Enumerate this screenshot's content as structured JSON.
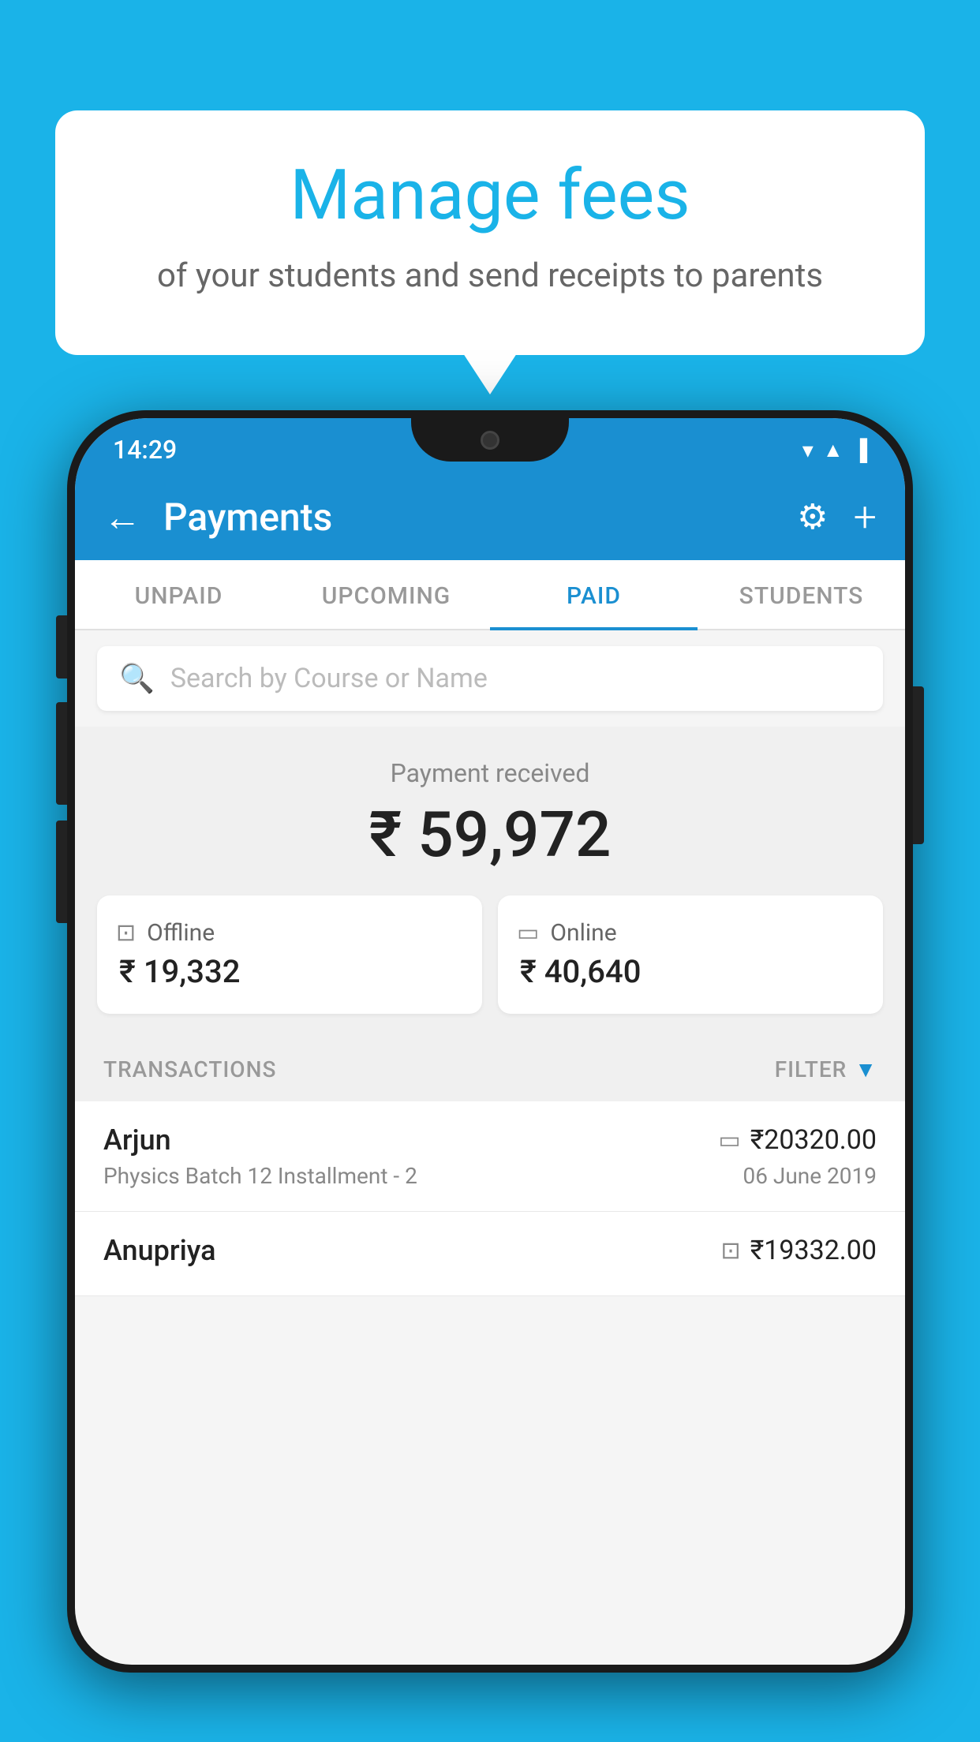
{
  "background_color": "#1ab3e8",
  "bubble": {
    "title": "Manage fees",
    "subtitle": "of your students and send receipts to parents"
  },
  "phone": {
    "status_bar": {
      "time": "14:29",
      "wifi": "▼",
      "signal": "▲",
      "battery": "▐"
    },
    "header": {
      "back_label": "←",
      "title": "Payments",
      "gear_label": "⚙",
      "plus_label": "+"
    },
    "tabs": [
      {
        "label": "UNPAID",
        "active": false
      },
      {
        "label": "UPCOMING",
        "active": false
      },
      {
        "label": "PAID",
        "active": true
      },
      {
        "label": "STUDENTS",
        "active": false
      }
    ],
    "search": {
      "placeholder": "Search by Course or Name"
    },
    "payment_received": {
      "label": "Payment received",
      "amount": "₹ 59,972",
      "offline": {
        "type": "Offline",
        "amount": "₹ 19,332"
      },
      "online": {
        "type": "Online",
        "amount": "₹ 40,640"
      }
    },
    "transactions": {
      "label": "TRANSACTIONS",
      "filter_label": "FILTER",
      "rows": [
        {
          "name": "Arjun",
          "amount": "₹20320.00",
          "course": "Physics Batch 12 Installment - 2",
          "date": "06 June 2019",
          "payment_type": "online"
        },
        {
          "name": "Anupriya",
          "amount": "₹19332.00",
          "course": "",
          "date": "",
          "payment_type": "offline"
        }
      ]
    }
  }
}
